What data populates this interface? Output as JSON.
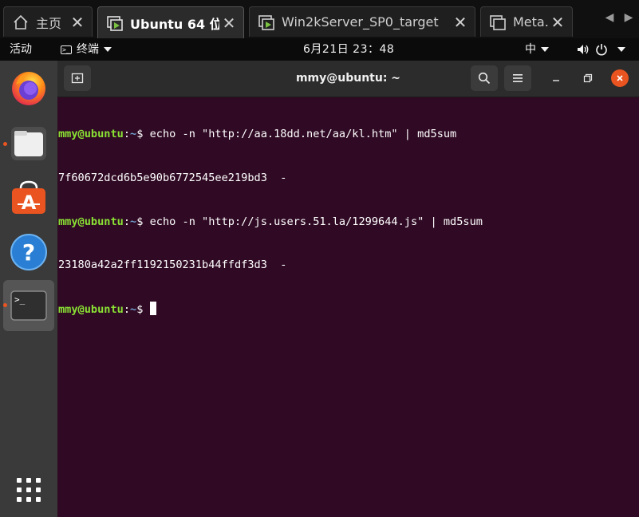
{
  "vm_tabs": [
    {
      "label": "主页",
      "icon": "home-icon",
      "active": false
    },
    {
      "label": "Ubuntu 64 位",
      "icon": "vm-icon",
      "active": true
    },
    {
      "label": "Win2kServer_SP0_target",
      "icon": "vm-icon",
      "active": false
    },
    {
      "label": "Meta...",
      "icon": "vm-window-icon",
      "active": false
    }
  ],
  "topbar": {
    "activities": "活动",
    "app_name": "终端",
    "clock": "6月21日  23：48",
    "input_method": "中"
  },
  "dock": {
    "items": [
      {
        "name": "firefox-icon",
        "running": false
      },
      {
        "name": "files-icon",
        "running": true
      },
      {
        "name": "software-center-icon",
        "running": false
      },
      {
        "name": "help-icon",
        "running": false
      },
      {
        "name": "terminal-icon",
        "running": true,
        "active": true
      }
    ],
    "show_apps": "show-apps-grid-icon"
  },
  "terminal": {
    "title": "mmy@ubuntu: ~",
    "prompt_user": "mmy@ubuntu",
    "prompt_path": "~",
    "lines": [
      {
        "type": "cmd",
        "text": "$ echo -n \"http://aa.18dd.net/aa/kl.htm\" | md5sum"
      },
      {
        "type": "out",
        "text": "7f60672dcd6b5e90b6772545ee219bd3  -"
      },
      {
        "type": "cmd",
        "text": "$ echo -n \"http://js.users.51.la/1299644.js\" | md5sum"
      },
      {
        "type": "out",
        "text": "23180a42a2ff1192150231b44ffdf3d3  -"
      },
      {
        "type": "prompt",
        "text": "$ "
      }
    ]
  },
  "colors": {
    "terminal_bg": "#300a24",
    "prompt_user": "#8ae234",
    "prompt_path": "#729fcf",
    "ubuntu_orange": "#e95420"
  }
}
